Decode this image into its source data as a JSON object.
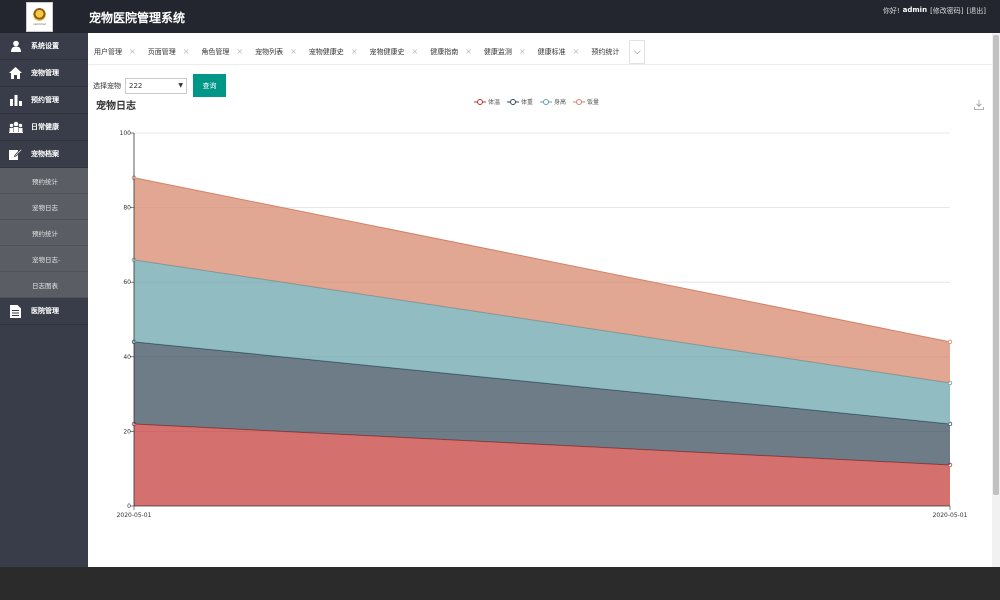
{
  "app": {
    "title": "宠物医院管理系统",
    "logo_text": "remimal"
  },
  "user": {
    "greeting": "你好!",
    "name": "admin",
    "change_password": "[修改密码]",
    "logout": "[退出]"
  },
  "sidebar": {
    "items": [
      {
        "label": "系统设置",
        "icon": "user-icon"
      },
      {
        "label": "宠物管理",
        "icon": "home-icon"
      },
      {
        "label": "预约管理",
        "icon": "bar-chart-icon"
      },
      {
        "label": "日常健康",
        "icon": "group-icon"
      },
      {
        "label": "宠物档案",
        "icon": "edit-icon"
      }
    ],
    "subitems": [
      "预约统计",
      "宠物日志",
      "预约统计",
      "宠物日志-",
      "日志图表"
    ],
    "last_item": {
      "label": "医院管理",
      "icon": "document-icon"
    }
  },
  "tabs": [
    {
      "label": "用户管理"
    },
    {
      "label": "页面管理"
    },
    {
      "label": "角色管理"
    },
    {
      "label": "宠物列表"
    },
    {
      "label": "宠物健康史"
    },
    {
      "label": "宠物健康史"
    },
    {
      "label": "健康指南"
    },
    {
      "label": "健康监测"
    },
    {
      "label": "健康标准"
    },
    {
      "label": "预约统计"
    }
  ],
  "filter": {
    "label": "选择宠物",
    "selected": "222",
    "button": "查询"
  },
  "chart_data": {
    "type": "area",
    "stacked": true,
    "title": "宠物日志",
    "x": [
      "2020-05-01",
      "2020-05-01"
    ],
    "series": [
      {
        "name": "体温",
        "values": [
          22,
          11
        ],
        "color": "#c23531"
      },
      {
        "name": "体重",
        "values": [
          22,
          11
        ],
        "color": "#2f4554"
      },
      {
        "name": "身高",
        "values": [
          22,
          11
        ],
        "color": "#61a0a8"
      },
      {
        "name": "饭量",
        "values": [
          22,
          11
        ],
        "color": "#d48265"
      }
    ],
    "ylim": [
      0,
      100
    ],
    "yticks": [
      0,
      20,
      40,
      60,
      80,
      100
    ],
    "grid": true,
    "legend_position": "top-center"
  }
}
